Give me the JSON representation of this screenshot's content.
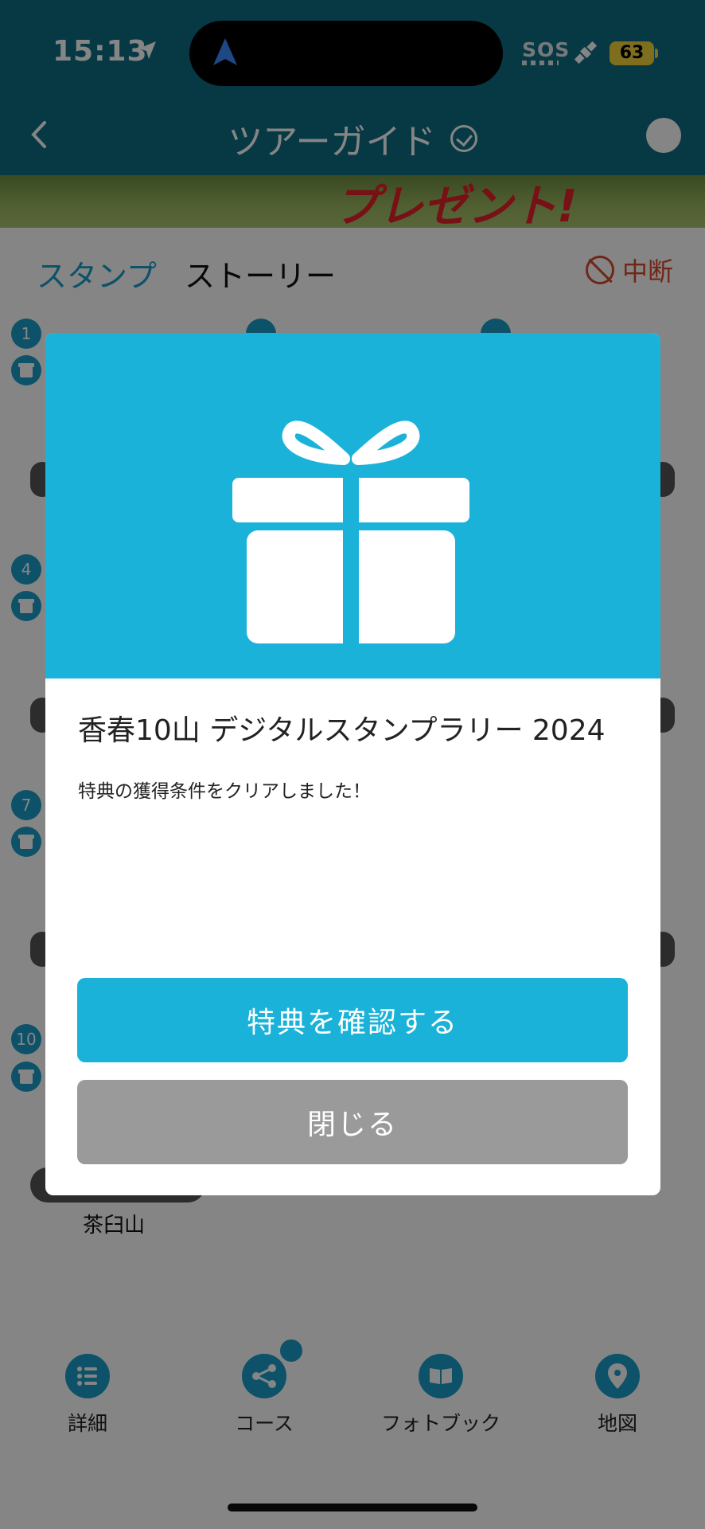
{
  "status_bar": {
    "time": "15:13",
    "sos": "SOS",
    "battery": "63"
  },
  "nav": {
    "title": "ツアーガイド"
  },
  "banner": {
    "text": "プレゼント!"
  },
  "tabs": {
    "stamp": "スタンプ",
    "story": "ストーリー",
    "interrupt": "中断"
  },
  "grid": {
    "numbers": [
      "1",
      "4",
      "7",
      "10"
    ],
    "mountain_label": "茶臼山"
  },
  "bottom_nav": [
    {
      "label": "詳細",
      "icon": "list-icon"
    },
    {
      "label": "コース",
      "icon": "share-icon"
    },
    {
      "label": "フォトブック",
      "icon": "book-icon"
    },
    {
      "label": "地図",
      "icon": "map-pin-icon"
    }
  ],
  "modal": {
    "title": "香春10山 デジタルスタンプラリー 2024",
    "message": "特典の獲得条件をクリアしました！",
    "confirm_label": "特典を確認する",
    "close_label": "閉じる",
    "accent_color": "#1ab2d9"
  }
}
